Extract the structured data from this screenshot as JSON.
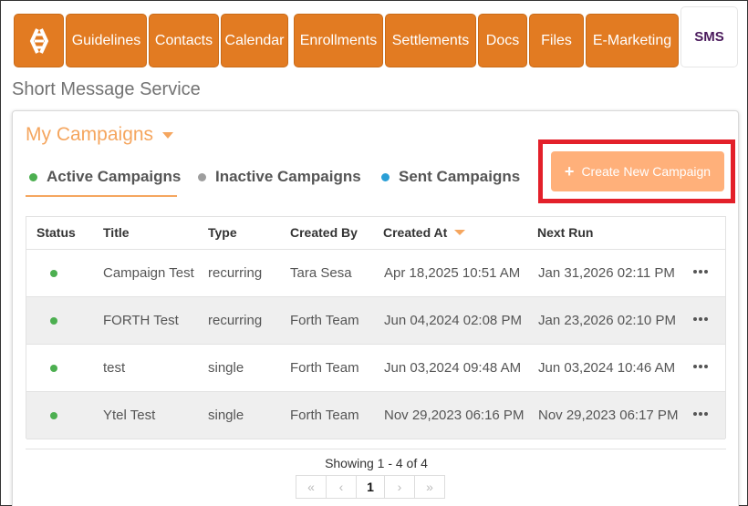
{
  "tabs": [
    {
      "label": "Guidelines"
    },
    {
      "label": "Contacts"
    },
    {
      "label": "Calendar"
    },
    {
      "label": "Enrollments"
    },
    {
      "label": "Settlements"
    },
    {
      "label": "Docs"
    },
    {
      "label": "Files"
    },
    {
      "label": "E-Marketing"
    },
    {
      "label": "SMS",
      "active": true
    }
  ],
  "page_title": "Short Message Service",
  "campaigns_menu": {
    "label": "My Campaigns"
  },
  "filters": [
    {
      "label": "Active Campaigns",
      "color": "#4caf50",
      "active": true
    },
    {
      "label": "Inactive Campaigns",
      "color": "#9e9e9e"
    },
    {
      "label": "Sent Campaigns",
      "color": "#2a9fd6"
    }
  ],
  "create_button": {
    "plus": "+",
    "label": "Create New Campaign"
  },
  "table": {
    "columns": [
      "Status",
      "Title",
      "Type",
      "Created By",
      "Created At",
      "Next Run"
    ],
    "rows": [
      {
        "title": "Campaign Test",
        "type": "recurring",
        "created_by": "Tara Sesa",
        "created_at": "Apr 18,2025 10:51 AM",
        "next_run": "Jan 31,2026 02:11 PM"
      },
      {
        "title": "FORTH Test",
        "type": "recurring",
        "created_by": "Forth Team",
        "created_at": "Jun 04,2024 02:08 PM",
        "next_run": "Jan 23,2026 02:10 PM"
      },
      {
        "title": "test",
        "type": "single",
        "created_by": "Forth Team",
        "created_at": "Jun 03,2024 09:48 AM",
        "next_run": "Jun 03,2024 10:46 AM"
      },
      {
        "title": "Ytel Test",
        "type": "single",
        "created_by": "Forth Team",
        "created_at": "Nov 29,2023 06:16 PM",
        "next_run": "Nov 29,2023 06:17 PM"
      }
    ]
  },
  "pagination": {
    "showing": "Showing 1 - 4 of 4",
    "first": "«",
    "prev": "‹",
    "current": "1",
    "next": "›",
    "last": "»"
  },
  "colors": {
    "tab": "#e27b22",
    "accent": "#f5a65f",
    "button": "#ffb07a",
    "highlight": "#e3202a"
  }
}
